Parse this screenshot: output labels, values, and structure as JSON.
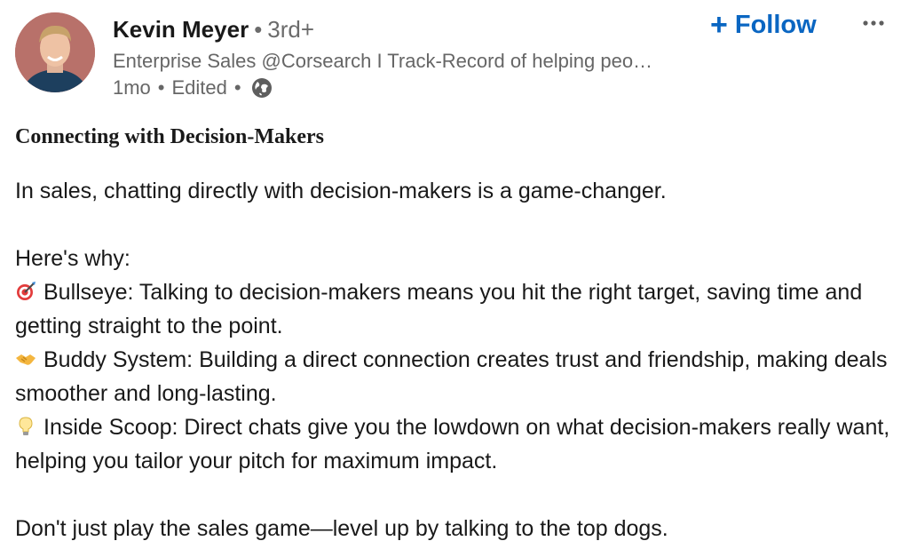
{
  "author": {
    "name": "Kevin Meyer",
    "separator": "•",
    "degree": "3rd+",
    "headline": "Enterprise Sales @Corsearch I Track-Record of helping peo…",
    "time": "1mo",
    "edited": "Edited",
    "visibility_icon": "globe-icon"
  },
  "actions": {
    "follow_plus": "+",
    "follow_label": "Follow",
    "more_icon": "more-horizontal-icon"
  },
  "post": {
    "title": "Connecting with Decision-Makers",
    "intro": "In sales, chatting directly with decision-makers is a game-changer.",
    "why": "Here's why:",
    "points": [
      {
        "icon": "bullseye-emoji",
        "text": "Bullseye: Talking to decision-makers means you hit the right target, saving time and getting straight to the point."
      },
      {
        "icon": "handshake-emoji",
        "text": "Buddy System: Building a direct connection creates trust and friendship, making deals smoother and long-lasting."
      },
      {
        "icon": "lightbulb-emoji",
        "text": "Inside Scoop: Direct chats give you the lowdown on what decision-makers really want, helping you tailor your pitch for maximum impact."
      }
    ],
    "closing": "Don't just play the sales game—level up by talking to the top dogs."
  },
  "colors": {
    "link_blue": "#0a66c2",
    "text_primary": "#191919",
    "text_secondary": "#666666"
  }
}
